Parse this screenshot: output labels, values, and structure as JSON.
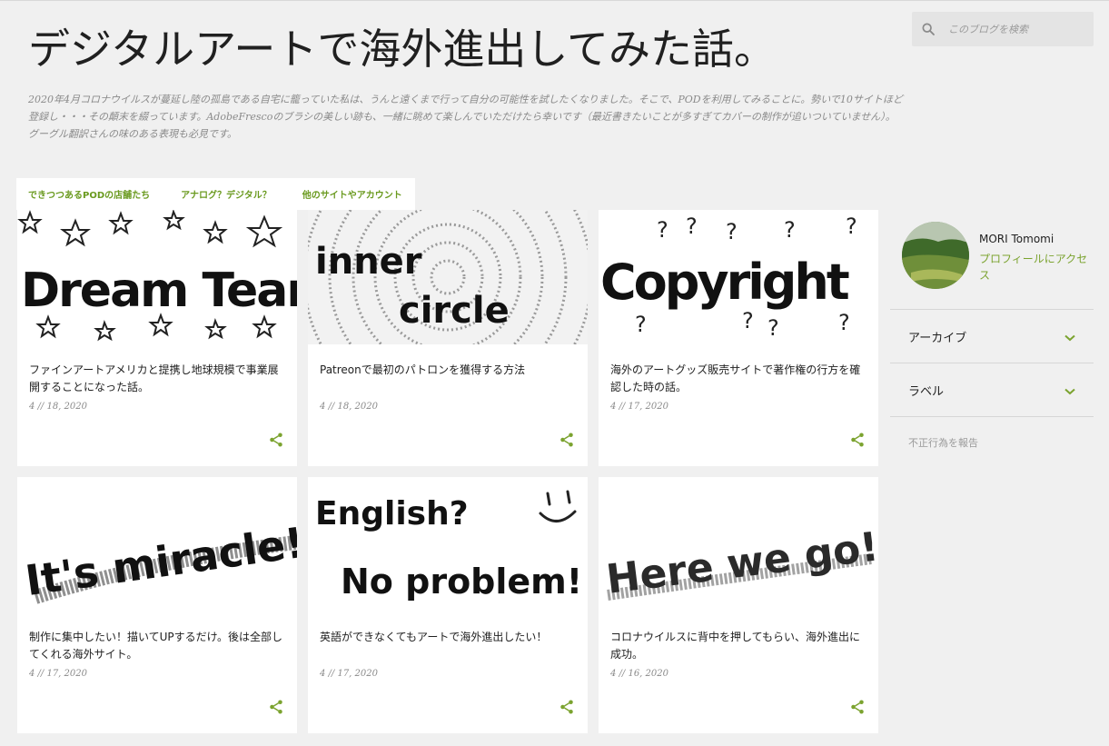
{
  "header": {
    "title": "デジタルアートで海外進出してみた話。",
    "description": "2020年4月コロナウイルスが蔓延し陸の孤島である自宅に籠っていた私は、うんと遠くまで行って自分の可能性を試したくなりました。そこで、PODを利用してみることに。勢いで10サイトほど登録し・・・その顛末を綴っています。AdobeFrescoのブラシの美しい跡も、一緒に眺めて楽しんでいただけたら幸いです（最近書きたいことが多すぎてカバーの制作が追いついていません）。グーグル翻訳さんの味のある表現も必見です。"
  },
  "search": {
    "placeholder": "このブログを検索"
  },
  "tabs": [
    {
      "label": "できつつあるPODの店舗たち"
    },
    {
      "label": "アナログ？デジタル？"
    },
    {
      "label": "他のサイトやアカウント"
    }
  ],
  "posts": [
    {
      "title": "ファインアートアメリカと提携し地球規模で事業展開することになった話。",
      "date": "4 // 18, 2020",
      "cover": "Dream Team"
    },
    {
      "title": "Patreonで最初のパトロンを獲得する方法",
      "date": "4 // 18, 2020",
      "cover": "inner circle"
    },
    {
      "title": "海外のアートグッズ販売サイトで著作権の行方を確認した時の話。",
      "date": "4 // 17, 2020",
      "cover": "Copyright"
    },
    {
      "title": "制作に集中したい！描いてUPするだけ。後は全部してくれる海外サイト。",
      "date": "4 // 17, 2020",
      "cover": "It's miracle!"
    },
    {
      "title": "英語ができなくてもアートで海外進出したい！",
      "date": "4 // 17, 2020",
      "cover": "English? No problem!"
    },
    {
      "title": "コロナウイルスに背中を押してもらい、海外進出に成功。",
      "date": "4 // 16, 2020",
      "cover": "Here we go!!"
    }
  ],
  "profile": {
    "name": "MORI Tomomi",
    "link_label": "プロフィールにアクセス"
  },
  "widgets": {
    "archive": "アーカイブ",
    "labels": "ラベル",
    "report": "不正行為を報告"
  },
  "cover_text": {
    "c1": "Dream Team",
    "c2a": "inner",
    "c2b": "circle",
    "c3": "Copyright",
    "c4": "It's miracle!",
    "c5a": "English?",
    "c5b": "No problem!",
    "c6": "Here we go!!"
  },
  "colors": {
    "accent": "#7ba32f",
    "background": "#f0f0f0"
  }
}
